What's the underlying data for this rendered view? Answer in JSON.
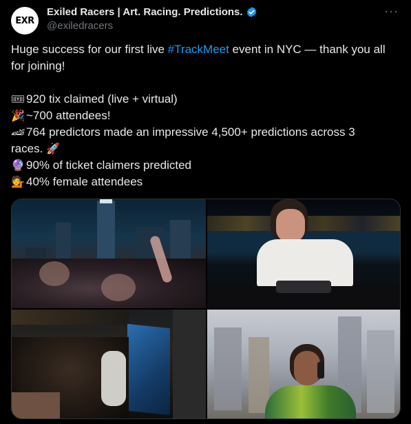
{
  "account": {
    "avatar_text": "EXR",
    "display_name": "Exiled Racers | Art. Racing. Predictions.",
    "handle": "@exiledracers",
    "verified": true
  },
  "more_label": "···",
  "tweet": {
    "intro_before": "Huge success for our first live ",
    "hashtag": "#TrackMeet",
    "intro_after": " event in NYC — thank you all",
    "intro_line2": "for joining!",
    "stats": [
      {
        "icon": "ticket-icon",
        "emoji": "🎟",
        "text": "920 tix claimed (live + virtual)"
      },
      {
        "icon": "party-popper-icon",
        "emoji": "🎉",
        "text": "~700 attendees!"
      },
      {
        "icon": "racing-car-icon",
        "emoji": "🏎",
        "text": "764 predictors made an impressive 4,500+ predictions across 3"
      },
      {
        "icon": "rocket-icon",
        "emoji": "🚀",
        "text_before": "races. "
      },
      {
        "icon": "crystal-ball-icon",
        "emoji": "🔮",
        "text": "90% of ticket claimers predicted"
      },
      {
        "icon": "woman-tipping-hand-icon",
        "emoji": "💁",
        "text": "40% female attendees"
      }
    ]
  },
  "media": {
    "images": [
      {
        "name": "rooftop-crowd-skyline-photo"
      },
      {
        "name": "dj-skyline-photo"
      },
      {
        "name": "indoor-crowd-screen-photo"
      },
      {
        "name": "woman-phone-skyline-photo"
      }
    ]
  },
  "colors": {
    "background": "#000000",
    "text": "#e7e9ea",
    "secondary": "#71767b",
    "accent": "#1d9bf0"
  }
}
